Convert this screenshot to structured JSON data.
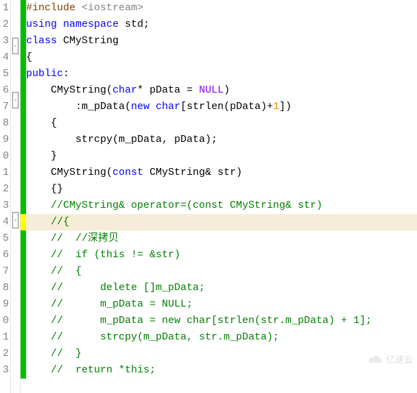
{
  "gutter": [
    "1",
    "2",
    "3",
    "4",
    "5",
    "6",
    "7",
    "8",
    "9",
    "0",
    "1",
    "2",
    "3",
    "4",
    "5",
    "6",
    "7",
    "8",
    "9",
    "0",
    "1",
    "2",
    "3"
  ],
  "fold": [
    "",
    "",
    "-",
    "",
    "",
    "-",
    "",
    "",
    "",
    "",
    "",
    "",
    "-",
    "",
    "",
    "",
    "",
    "",
    "",
    "",
    "",
    "",
    ""
  ],
  "mark": [
    "g",
    "g",
    "g",
    "g",
    "g",
    "g",
    "g",
    "g",
    "g",
    "g",
    "g",
    "g",
    "g",
    "y",
    "g",
    "g",
    "g",
    "g",
    "g",
    "g",
    "g",
    "g",
    "g"
  ],
  "lines": {
    "l1": {
      "a": "#include ",
      "b": "<iostream>"
    },
    "l2": {
      "a": "using ",
      "b": "namespace ",
      "c": "std;"
    },
    "l3": {
      "a": "class ",
      "b": "CMyString"
    },
    "l4": {
      "a": "{"
    },
    "l5": {
      "a": "public",
      "b": ":"
    },
    "l6": {
      "a": "    CMyString(",
      "b": "char",
      "c": "* pData = ",
      "d": "NULL",
      "e": ")"
    },
    "l7": {
      "a": "        :m_pData(",
      "b": "new ",
      "c": "char",
      "d": "[strlen(pData)+",
      "e": "1",
      "f": "])"
    },
    "l8": {
      "a": "    {"
    },
    "l9": {
      "a": "        strcpy(m_pData, pData);"
    },
    "l10": {
      "a": "    }"
    },
    "l11": {
      "a": "    CMyString(",
      "b": "const ",
      "c": "CMyString& str)"
    },
    "l12": {
      "a": "    {}"
    },
    "l13": {
      "a": "    //CMyString& operator=(const CMyString& str)"
    },
    "l14": {
      "a": "    //{"
    },
    "l15": {
      "a": "    //  //深拷贝"
    },
    "l16": {
      "a": "    //  if (this != &str)"
    },
    "l17": {
      "a": "    //  {"
    },
    "l18": {
      "a": "    //      delete []m_pData;"
    },
    "l19": {
      "a": "    //      m_pData = NULL;"
    },
    "l20": {
      "a": "    //      m_pData = new char[strlen(str.m_pData) + 1];"
    },
    "l21": {
      "a": "    //      strcpy(m_pData, str.m_pData);"
    },
    "l22": {
      "a": "    //  }"
    },
    "l23": {
      "a": "    //  return *this;"
    }
  },
  "watermark": "亿速云"
}
